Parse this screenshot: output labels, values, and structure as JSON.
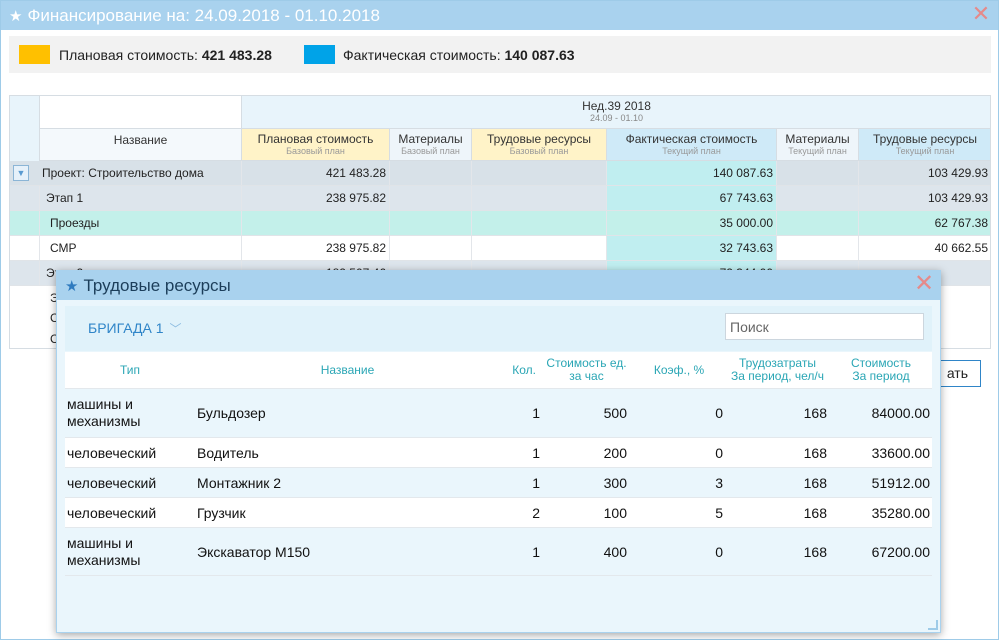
{
  "main_window": {
    "title": "Финансирование на: 24.09.2018 - 01.10.2018",
    "colors": {
      "planned": "#ffc000",
      "actual": "#00a3e8",
      "title_bg": "#a9d2ee"
    },
    "legend": {
      "planned_label": "Плановая стоимость:",
      "planned_value": "421 483.28",
      "actual_label": "Фактическая стоимость:",
      "actual_value": "140 087.63"
    },
    "grid": {
      "week_label": "Нед.39 2018",
      "week_range": "24.09 - 01.10",
      "columns": [
        {
          "title": "Название",
          "subtitle": ""
        },
        {
          "title": "Плановая стоимость",
          "subtitle": "Базовый план"
        },
        {
          "title": "Материалы",
          "subtitle": "Базовый план"
        },
        {
          "title": "Трудовые ресурсы",
          "subtitle": "Базовый план"
        },
        {
          "title": "Фактическая стоимость",
          "subtitle": "Текущий план"
        },
        {
          "title": "Материалы",
          "subtitle": "Текущий план"
        },
        {
          "title": "Трудовые ресурсы",
          "subtitle": "Текущий план"
        }
      ],
      "rows": [
        {
          "name": "Проект: Строительство дома",
          "planned": "421 483.28",
          "mat_base": "",
          "labor_base": "",
          "actual": "140 087.63",
          "mat_cur": "",
          "labor_cur": "103 429.93"
        },
        {
          "name": "Этап 1",
          "planned": "238 975.82",
          "mat_base": "",
          "labor_base": "",
          "actual": "67 743.63",
          "mat_cur": "",
          "labor_cur": "103 429.93"
        },
        {
          "name": "Проезды",
          "planned": "",
          "mat_base": "",
          "labor_base": "",
          "actual": "35 000.00",
          "mat_cur": "",
          "labor_cur": "62 767.38"
        },
        {
          "name": "СМР",
          "planned": "238 975.82",
          "mat_base": "",
          "labor_base": "",
          "actual": "32 743.63",
          "mat_cur": "",
          "labor_cur": "40 662.55"
        },
        {
          "name": "Этап 2",
          "planned": "182 507.46",
          "mat_base": "",
          "labor_base": "",
          "actual": "72 344.00",
          "mat_cur": "",
          "labor_cur": ""
        },
        {
          "name": "Э",
          "planned": "",
          "mat_base": "",
          "labor_base": "",
          "actual": "",
          "mat_cur": "",
          "labor_cur": ""
        },
        {
          "name": "С",
          "planned": "",
          "mat_base": "",
          "labor_base": "",
          "actual": "",
          "mat_cur": "",
          "labor_cur": ""
        },
        {
          "name": "С",
          "planned": "",
          "mat_base": "",
          "labor_base": "",
          "actual": "",
          "mat_cur": "",
          "labor_cur": ""
        }
      ]
    },
    "partial_button_label": "ать"
  },
  "popup": {
    "title": "Трудовые ресурсы",
    "brigade_label": "БРИГАДА 1",
    "search_placeholder": "Поиск",
    "columns": {
      "type": "Тип",
      "name": "Название",
      "qty": "Кол.",
      "unit_cost_1": "Стоимость ед.",
      "unit_cost_2": "за час",
      "coef": "Коэф., %",
      "labor_1": "Трудозатраты",
      "labor_2": "За период, чел/ч",
      "cost_1": "Стоимость",
      "cost_2": "За период"
    },
    "rows": [
      {
        "type": "машины и механизмы",
        "name": "Бульдозер",
        "qty": "1",
        "unit_cost": "500",
        "coef": "0",
        "labor": "168",
        "cost": "84000.00"
      },
      {
        "type": "человеческий",
        "name": "Водитель",
        "qty": "1",
        "unit_cost": "200",
        "coef": "0",
        "labor": "168",
        "cost": "33600.00"
      },
      {
        "type": "человеческий",
        "name": "Монтажник 2",
        "qty": "1",
        "unit_cost": "300",
        "coef": "3",
        "labor": "168",
        "cost": "51912.00"
      },
      {
        "type": "человеческий",
        "name": "Грузчик",
        "qty": "2",
        "unit_cost": "100",
        "coef": "5",
        "labor": "168",
        "cost": "35280.00"
      },
      {
        "type": "машины и механизмы",
        "name": "Экскаватор М150",
        "qty": "1",
        "unit_cost": "400",
        "coef": "0",
        "labor": "168",
        "cost": "67200.00"
      }
    ]
  }
}
